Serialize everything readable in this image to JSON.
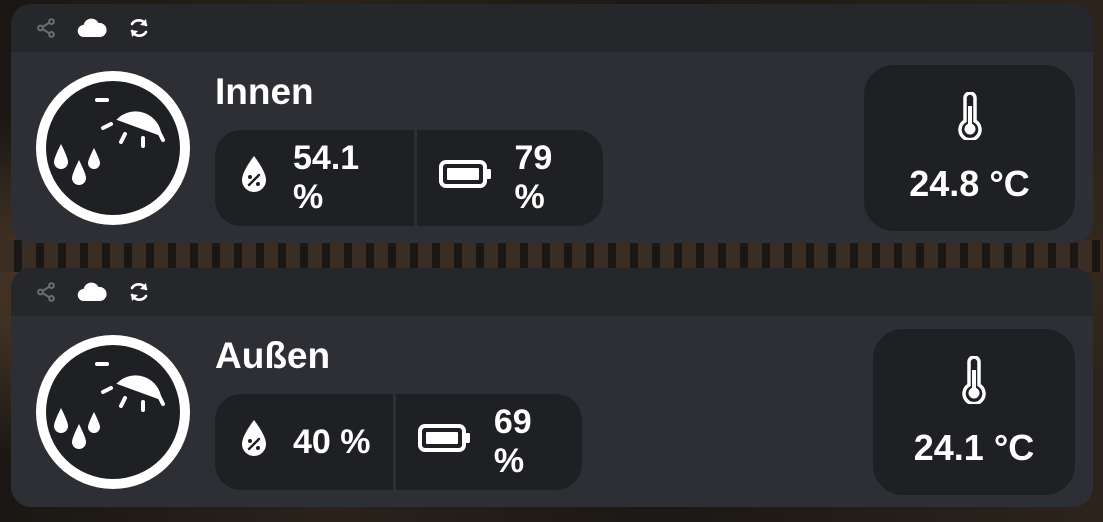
{
  "devices": [
    {
      "name": "Innen",
      "humidity": "54.1 %",
      "battery": "79 %",
      "temperature": "24.8 °C",
      "weather_icon": "weather-sun-rain-icon"
    },
    {
      "name": "Außen",
      "humidity": "40 %",
      "battery": "69 %",
      "temperature": "24.1 °C",
      "weather_icon": "weather-sun-rain-icon"
    }
  ],
  "toolbar_icons": [
    "share-icon",
    "cloud-icon",
    "sync-icon"
  ],
  "colors": {
    "card": "#2e2f34",
    "card_header": "#26272b",
    "pill": "#1f2023",
    "text": "#ffffff",
    "share_icon": "#6b6d73"
  }
}
